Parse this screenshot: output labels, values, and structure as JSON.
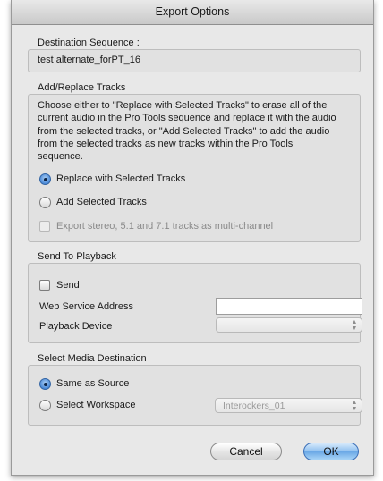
{
  "window": {
    "title": "Export Options"
  },
  "destination": {
    "label": "Destination Sequence :",
    "value": "test alternate_forPT_16"
  },
  "add_replace": {
    "label": "Add/Replace Tracks",
    "description": [
      "Choose either to \"Replace with Selected Tracks\" to erase all of the",
      "current audio in the Pro Tools sequence and replace it with the audio",
      "from the selected tracks, or \"Add Selected Tracks\" to add the audio",
      "from the selected tracks as new tracks within the Pro Tools",
      "sequence."
    ],
    "options": [
      {
        "label": "Replace with Selected Tracks",
        "selected": true
      },
      {
        "label": "Add Selected Tracks",
        "selected": false
      }
    ],
    "multichannel": {
      "label": "Export stereo, 5.1 and 7.1 tracks as multi-channel",
      "checked": false,
      "enabled": false
    }
  },
  "send_to_playback": {
    "label": "Send To Playback",
    "send": {
      "label": "Send",
      "checked": false
    },
    "web_service_label": "Web Service Address",
    "web_service_value": "",
    "playback_device_label": "Playback Device",
    "playback_device_value": ""
  },
  "media_destination": {
    "label": "Select Media Destination",
    "options": [
      {
        "label": "Same as Source",
        "selected": true
      },
      {
        "label": "Select Workspace",
        "selected": false
      }
    ],
    "workspace_value": "Interockers_01"
  },
  "buttons": {
    "cancel": "Cancel",
    "ok": "OK"
  }
}
